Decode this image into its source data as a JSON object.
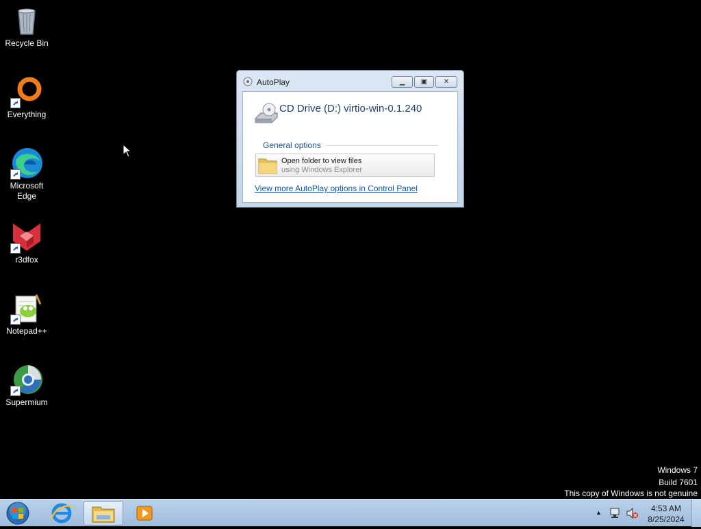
{
  "desktop": {
    "icons": [
      {
        "label": "Recycle Bin",
        "icon": "recycle-bin-icon"
      },
      {
        "label": "Everything",
        "icon": "everything-icon"
      },
      {
        "label": "Microsoft Edge",
        "icon": "edge-icon"
      },
      {
        "label": "r3dfox",
        "icon": "r3dfox-icon"
      },
      {
        "label": "Notepad++",
        "icon": "notepadpp-icon"
      },
      {
        "label": "Supermium",
        "icon": "supermium-icon"
      }
    ]
  },
  "autoplay": {
    "window_title": "AutoPlay",
    "drive_title": "CD Drive (D:) virtio-win-0.1.240",
    "section_label": "General options",
    "option": {
      "title": "Open folder to view files",
      "subtitle": "using Windows Explorer"
    },
    "control_panel_link": "View more AutoPlay options in Control Panel"
  },
  "watermark": {
    "line1": "Windows 7",
    "line2": "Build 7601",
    "line3": "This copy of Windows is not genuine"
  },
  "taskbar": {
    "items": [
      "start-button",
      "internet-explorer",
      "windows-explorer",
      "media-player"
    ],
    "clock": {
      "time": "4:53 AM",
      "date": "8/25/2024"
    }
  },
  "colors": {
    "desktop_bg": "#000000",
    "taskbar": "#a9c3e0",
    "link": "#0b55b6",
    "title_blue": "#1e3e73"
  }
}
